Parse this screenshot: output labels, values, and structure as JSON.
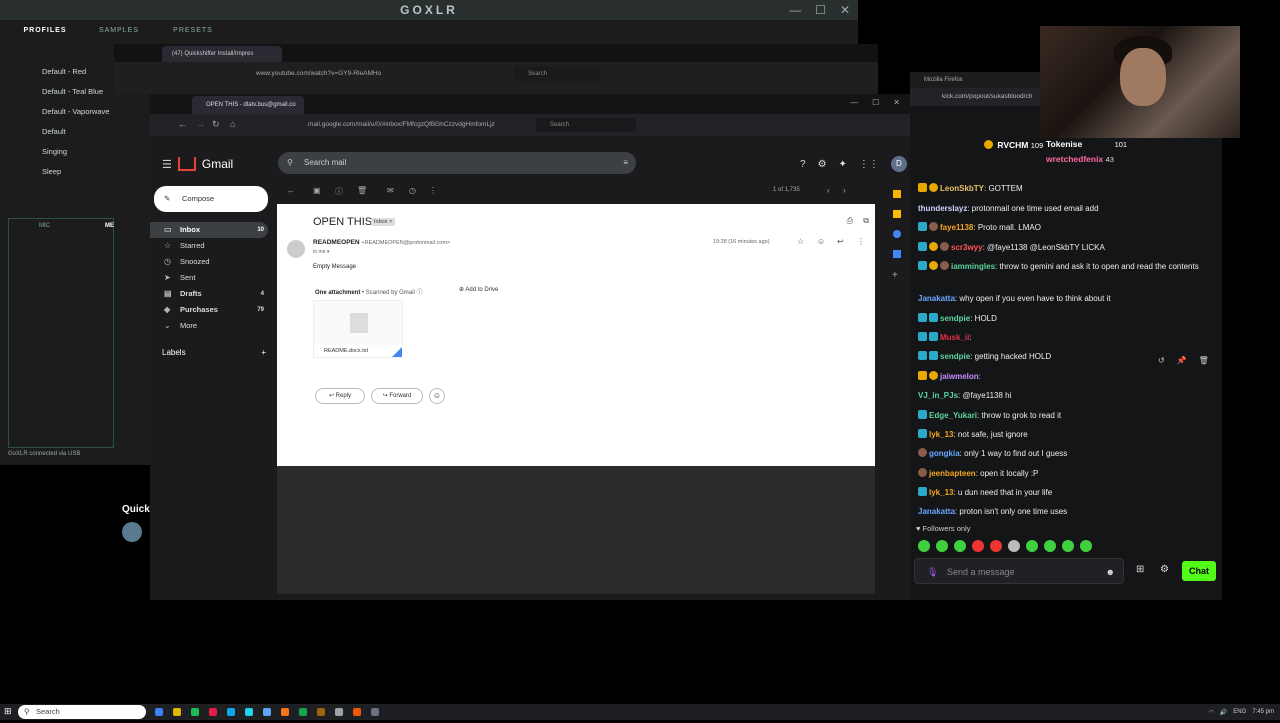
{
  "goxlr": {
    "title": "GOXLR",
    "tabs": [
      "PROFILES",
      "SAMPLES",
      "PRESETS"
    ],
    "profiles": [
      "Default - Red",
      "Default - Teal Blue",
      "Default - Vaporwave",
      "Default",
      "Singing",
      "Sleep"
    ],
    "mic_tab": "MIC",
    "mic_tab2": "ME",
    "status": "GoXLR connected via USB"
  },
  "youtube_window": {
    "tab_title": "(47) Quickshifter Install/Impres",
    "url": "www.youtube.com/watch?v=GY9-RleAMHo",
    "search_placeholder": "Search"
  },
  "gmail_window": {
    "tab_title": "OPEN THIS - dlatv.bus@gmail.co",
    "url": "mail.google.com/mail/u/0/#inbox/FMfcgzQfBGhCzzvdgHmfomLjz",
    "search_placeholder": "Search",
    "app_name": "Gmail",
    "search_mail": "Search mail",
    "compose": "Compose",
    "avatar_letter": "D",
    "nav": [
      {
        "label": "Inbox",
        "count": "10",
        "icon": "inbox-icon"
      },
      {
        "label": "Starred",
        "count": "",
        "icon": "star-icon"
      },
      {
        "label": "Snoozed",
        "count": "",
        "icon": "clock-icon"
      },
      {
        "label": "Sent",
        "count": "",
        "icon": "send-icon"
      },
      {
        "label": "Drafts",
        "count": "4",
        "icon": "draft-icon"
      },
      {
        "label": "Purchases",
        "count": "79",
        "icon": "tag-icon"
      },
      {
        "label": "More",
        "count": "",
        "icon": "chevron-down-icon"
      }
    ],
    "labels_header": "Labels",
    "pager": "1 of 1,735",
    "email": {
      "subject": "OPEN THIS",
      "label_chip": "Inbox ×",
      "sender_name": "READMEOPEN",
      "sender_email": "<READMEOPEN@protonmail.com>",
      "to": "to me ▾",
      "time": "19:28 (16 minutes ago)",
      "body": "Empty Message",
      "attachment_header": "One attachment",
      "scanned": "• Scanned by Gmail ⓘ",
      "add_to_drive": "Add to Drive",
      "attachment_name": "README.docx.txt",
      "reply": "Reply",
      "forward": "Forward"
    }
  },
  "kick": {
    "window_title": "Mozilla Firefox",
    "url": "kick.com/popout/sukasblood/ch",
    "top_gifters": [
      {
        "name": "RVCHM",
        "count": "109"
      },
      {
        "name": "Tokenise",
        "count": "101"
      },
      {
        "name": "wretchedfenix",
        "count": "43"
      }
    ],
    "messages": [
      {
        "user": "LeonSkbTY",
        "text": ": GOTTEM",
        "color": "#e8c26a",
        "badges": [
          "b-crown",
          "b-gift"
        ]
      },
      {
        "user": "thunderslayz",
        "text": ": protonmail one time used email add",
        "color": "#d0d0ff",
        "badges": []
      },
      {
        "user": "faye1138",
        "text": ": Proto mall. LMAO",
        "color": "#f5a623",
        "badges": [
          "b-sub",
          "b-og"
        ]
      },
      {
        "user": "scr3wyy",
        "text": ": @faye1138 @LeonSkbTY LICKA",
        "color": "#ff5555",
        "badges": [
          "b-sub",
          "b-gift",
          "b-og"
        ]
      },
      {
        "user": "iammingles",
        "text": ": throw to gemini and ask it to open and read the contents",
        "color": "#5bd6a0",
        "badges": [
          "b-sub",
          "b-gift",
          "b-og"
        ]
      },
      {
        "user": "Janakatta",
        "text": ": why open if you even have to think about it",
        "color": "#6aa8ff",
        "badges": []
      },
      {
        "user": "sendpie",
        "text": ": HOLD",
        "color": "#5bd6a0",
        "badges": [
          "b-sub",
          "b-sub"
        ]
      },
      {
        "user": "Musk_ii",
        "text": ":",
        "color": "#e0304a",
        "badges": [
          "b-sub",
          "b-sub"
        ]
      },
      {
        "user": "sendpie",
        "text": ": getting hacked HOLD",
        "color": "#5bd6a0",
        "badges": [
          "b-sub",
          "b-sub"
        ]
      },
      {
        "user": "jaiwmelon",
        "text": ":",
        "color": "#c78cff",
        "badges": [
          "b-crown",
          "b-gift"
        ]
      },
      {
        "user": "VJ_in_PJs",
        "text": ": @faye1138 hi",
        "color": "#5bd6a0",
        "badges": []
      },
      {
        "user": "Edge_Yukari",
        "text": ": throw to grok to read it",
        "color": "#5bd6a0",
        "badges": [
          "b-sub"
        ]
      },
      {
        "user": "lyk_13",
        "text": ": not safe, just ignore",
        "color": "#f5a623",
        "badges": [
          "b-sub"
        ]
      },
      {
        "user": "gongkia",
        "text": ": only 1 way to find out I guess",
        "color": "#6aa8ff",
        "badges": [
          "b-og"
        ]
      },
      {
        "user": "jeenbapteen",
        "text": ": open it locally :P",
        "color": "#f5a623",
        "badges": [
          "b-og"
        ]
      },
      {
        "user": "lyk_13",
        "text": ": u dun need that in your life",
        "color": "#f5a623",
        "badges": [
          "b-sub"
        ]
      },
      {
        "user": "Janakatta",
        "text": ": proton isn't only one time uses",
        "color": "#6aa8ff",
        "badges": []
      }
    ],
    "followers_only": "♥ Followers only",
    "send_placeholder": "Send a message",
    "chat_button": "Chat"
  },
  "overlay": {
    "quick_text": "Quick"
  },
  "taskbar": {
    "search": "Search",
    "lang": "ENG",
    "time": "7:45 pm"
  }
}
